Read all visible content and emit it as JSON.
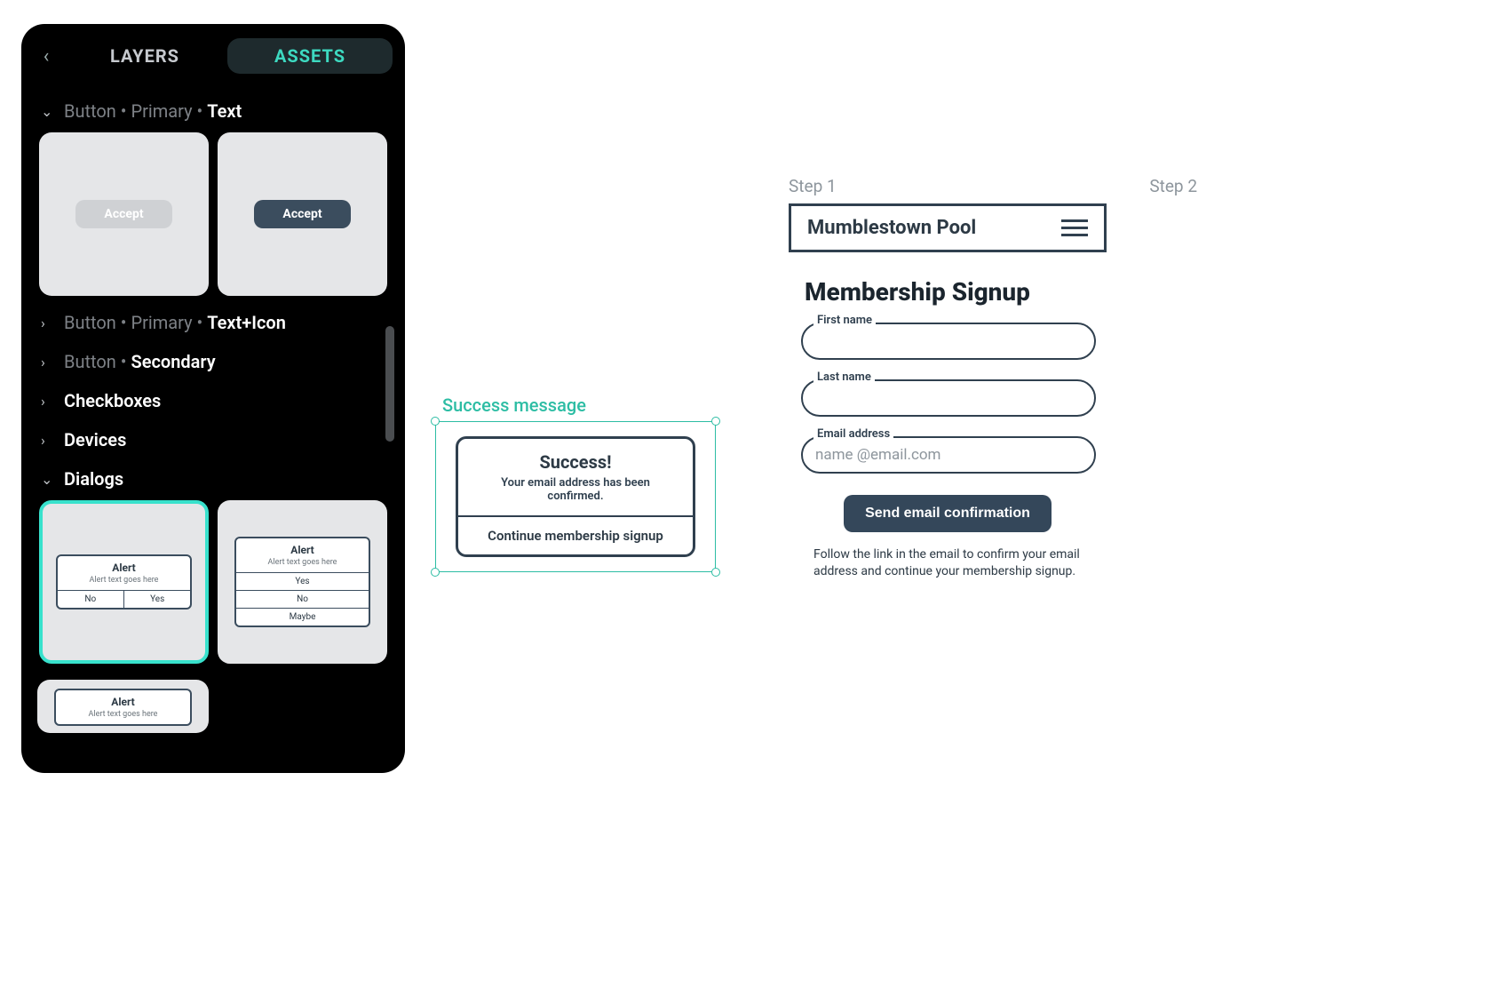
{
  "panel": {
    "tabs": {
      "layers": "LAYERS",
      "assets": "ASSETS"
    },
    "categories": [
      {
        "chev": "⌄",
        "dim": "Button • Primary • ",
        "bright": "Text"
      },
      {
        "chev": "›",
        "dim": "Button • Primary • ",
        "bright": "Text+Icon"
      },
      {
        "chev": "›",
        "dim": "Button • ",
        "bright": "Secondary"
      },
      {
        "chev": "›",
        "dim": "",
        "bright": "Checkboxes"
      },
      {
        "chev": "›",
        "dim": "",
        "bright": "Devices"
      },
      {
        "chev": "⌄",
        "dim": "",
        "bright": "Dialogs"
      }
    ],
    "button_thumbs": {
      "accept": "Accept"
    },
    "dialog_thumb": {
      "title": "Alert",
      "sub": "Alert text goes here",
      "no": "No",
      "yes": "Yes",
      "maybe": "Maybe"
    }
  },
  "canvas": {
    "selection_label": "Success message",
    "dlg": {
      "title": "Success!",
      "body": "Your email address has been confirmed.",
      "btn": "Continue membership signup"
    }
  },
  "mock": {
    "step1": "Step 1",
    "step2": "Step 2",
    "brand": "Mumblestown Pool",
    "heading": "Membership Signup",
    "first": "First name",
    "last": "Last name",
    "email_label": "Email address",
    "email_placeholder": "name @email.com",
    "cta": "Send email confirmation",
    "helper": "Follow the link in the email to confirm your email address and continue your membership signup."
  }
}
